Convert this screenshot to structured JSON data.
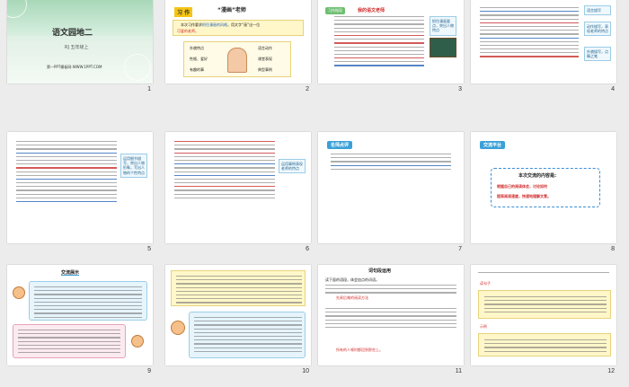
{
  "slides": [
    {
      "number": "1",
      "title": "语文园地二",
      "subtitle": "RJ  五年级上",
      "footer": "第一PPT模板网-WWW.1PPT.COM"
    },
    {
      "number": "2",
      "tag": "习  作",
      "heading": "“漫画”老师",
      "intro_a": "本次习作要求",
      "intro_highlight": "抓住漫画的风格",
      "intro_b": "，用文字“画”出一位",
      "intro_c": "可爱的老师。",
      "mindmap": [
        "外貌特点",
        "性格、爱好",
        "有趣的事",
        "语言动作",
        "课堂表现",
        "典型事例"
      ]
    },
    {
      "number": "3",
      "tag": "习作指导",
      "heading": "我的语文老师",
      "side_note": "抓住漫画要点，突出人物特点"
    },
    {
      "number": "4",
      "side_notes": [
        "语言描写",
        "动作描写，表现老师的特点",
        "外貌描写，点睛之笔"
      ]
    },
    {
      "number": "5",
      "side_note": "运用细节描写，突出人物形象，写出人物的个性特点"
    },
    {
      "number": "6",
      "side_note": "运用事例表现老师的特点"
    },
    {
      "number": "7",
      "tag": "名师点评"
    },
    {
      "number": "8",
      "tag": "交流平台",
      "box_title": "本次交流的内容是:",
      "box_line1": "根据自己的阅读体会，讨论如何",
      "box_line2": "提高阅读速度，快速地理解文意。"
    },
    {
      "number": "9",
      "title": "交流展示"
    },
    {
      "number": "10"
    },
    {
      "number": "11",
      "title": "词句段运用",
      "items": [
        "读下面的语段，体会加点的词语。",
        "先易后难的阅读方法",
        "所有的人顿时都回到那些上。"
      ]
    },
    {
      "number": "12",
      "labels": [
        "读句子",
        "示例",
        "例句"
      ]
    }
  ],
  "colors": {
    "accent_yellow": "#f4c515",
    "accent_blue": "#3aa0d8",
    "accent_red": "#d22b2b",
    "cover_green": "#a8d8b8"
  }
}
